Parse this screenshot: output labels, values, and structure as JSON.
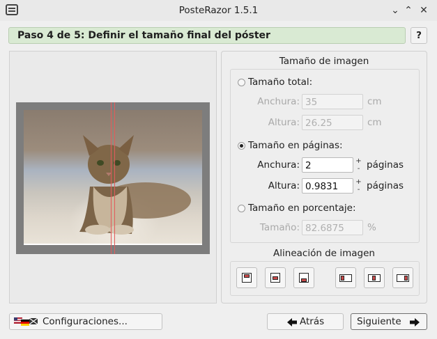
{
  "window": {
    "title": "PosteRazor 1.5.1",
    "controls": {
      "minimize": "⌄",
      "maximize": "⌃",
      "close": "✕"
    }
  },
  "header": {
    "step_title": "Paso 4 de 5: Definir el tamaño final del póster",
    "help_label": "?"
  },
  "image_size": {
    "title": "Tamaño de imagen",
    "total": {
      "label": "Tamaño total:",
      "selected": false,
      "width_label": "Anchura:",
      "width_value": "35",
      "width_unit": "cm",
      "height_label": "Altura:",
      "height_value": "26.25",
      "height_unit": "cm"
    },
    "pages": {
      "label": "Tamaño en páginas:",
      "selected": true,
      "width_label": "Anchura:",
      "width_value": "2",
      "width_unit": "páginas",
      "height_label": "Altura:",
      "height_value": "0.9831",
      "height_unit": "páginas"
    },
    "percent": {
      "label": "Tamaño en porcentaje:",
      "selected": false,
      "size_label": "Tamaño:",
      "size_value": "82.6875",
      "size_unit": "%"
    }
  },
  "alignment": {
    "title": "Alineación de imagen",
    "buttons": [
      "align-top",
      "align-vcenter",
      "align-bottom",
      "align-left",
      "align-hcenter",
      "align-right"
    ]
  },
  "footer": {
    "settings_label": "Configuraciones...",
    "back_label": "Atrás",
    "next_label": "Siguiente"
  },
  "colors": {
    "header_bg": "#d9ead3",
    "page_divider": "#e25b5b",
    "preview_border": "#7d7d7d"
  }
}
